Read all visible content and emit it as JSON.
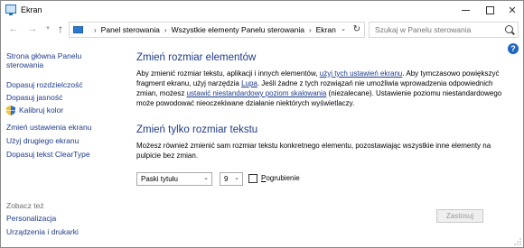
{
  "window": {
    "title": "Ekran"
  },
  "address": {
    "crumbs": [
      "Panel sterowania",
      "Wszystkie elementy Panelu sterowania",
      "Ekran"
    ],
    "refresh_icon": "refresh-icon",
    "dropdown_icon": "chevron-down-icon"
  },
  "search": {
    "placeholder": "Szukaj w Panelu sterowania"
  },
  "sidebar": {
    "home_label": "Strona główna Panelu sterowania",
    "items": [
      {
        "label": "Dopasuj rozdzielczość"
      },
      {
        "label": "Dopasuj jasność"
      },
      {
        "label": "Kalibruj kolor",
        "icon": "shield-icon"
      },
      {
        "label": "Zmień ustawienia ekranu"
      },
      {
        "label": "Użyj drugiego ekranu"
      },
      {
        "label": "Dopasuj tekst ClearType"
      }
    ],
    "see_also_label": "Zobacz też",
    "see_also_items": [
      {
        "label": "Personalizacja"
      },
      {
        "label": "Urządzenia i drukarki"
      }
    ]
  },
  "main": {
    "section1": {
      "heading": "Zmień rozmiar elementów",
      "text_a": "Aby zmienić rozmiar tekstu, aplikacji i innych elementów, ",
      "link_a": "użyj tych ustawień ekranu",
      "text_b": ". Aby tymczasowo powiększyć fragment ekranu, użyj narzędzia ",
      "link_b": "Lupa",
      "text_c": ". Jeśli żadne z tych rozwiązań nie umożliwia wprowadzenia odpowiednich zmian, możesz ",
      "link_c": "ustawić niestandardowy poziom skalowania",
      "text_d": " (niezalecane). Ustawienie poziomu niestandardowego może powodować nieoczekiwane działanie niektórych wyświetlaczy."
    },
    "section2": {
      "heading": "Zmień tylko rozmiar tekstu",
      "text": "Możesz również zmienić sam rozmiar tekstu konkretnego elementu, pozostawiając wszystkie inne elementy na pulpicie bez zmian.",
      "element_select_value": "Paski tytułu",
      "size_select_value": "9",
      "bold_checkbox_label_pre": "",
      "bold_checkbox_label_underlined": "P",
      "bold_checkbox_label_post": "ogrubienie",
      "bold_checked": false
    },
    "apply_button": "Zastosuj"
  },
  "colors": {
    "link": "#1e3b8a",
    "heading": "#1e3b8a",
    "disabled_text": "#9a9a9a"
  }
}
